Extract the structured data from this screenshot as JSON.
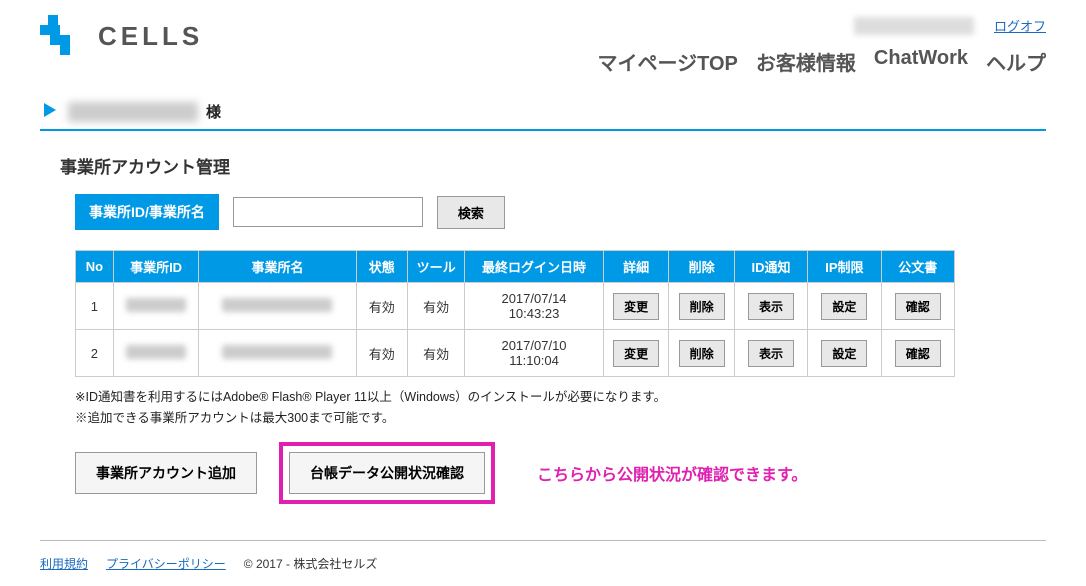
{
  "header": {
    "logo_text": "CELLS",
    "logoff": "ログオフ",
    "nav": [
      "マイページTOP",
      "お客様情報",
      "ChatWork",
      "ヘルプ"
    ]
  },
  "greeting": {
    "suffix": "様"
  },
  "section": {
    "title": "事業所アカウント管理"
  },
  "search": {
    "label": "事業所ID/事業所名",
    "value": "",
    "placeholder": "",
    "button": "検索"
  },
  "table": {
    "headers": [
      "No",
      "事業所ID",
      "事業所名",
      "状態",
      "ツール",
      "最終ログイン日時",
      "詳細",
      "削除",
      "ID通知",
      "IP制限",
      "公文書"
    ],
    "rows": [
      {
        "no": "1",
        "status": "有効",
        "tool": "有効",
        "last_login_date": "2017/07/14",
        "last_login_time": "10:43:23",
        "detail_btn": "変更",
        "delete_btn": "削除",
        "notify_btn": "表示",
        "ip_btn": "設定",
        "doc_btn": "確認"
      },
      {
        "no": "2",
        "status": "有効",
        "tool": "有効",
        "last_login_date": "2017/07/10",
        "last_login_time": "11:10:04",
        "detail_btn": "変更",
        "delete_btn": "削除",
        "notify_btn": "表示",
        "ip_btn": "設定",
        "doc_btn": "確認"
      }
    ]
  },
  "notes": {
    "line1": "※ID通知書を利用するにはAdobe® Flash® Player 11以上（Windows）のインストールが必要になります。",
    "line2": "※追加できる事業所アカウントは最大300まで可能です。"
  },
  "buttons": {
    "add_account": "事業所アカウント追加",
    "ledger_status": "台帳データ公開状況確認"
  },
  "callout": "こちらから公開状況が確認できます。",
  "footer": {
    "terms": "利用規約",
    "privacy": "プライバシーポリシー",
    "copyright": "© 2017 - 株式会社セルズ"
  }
}
